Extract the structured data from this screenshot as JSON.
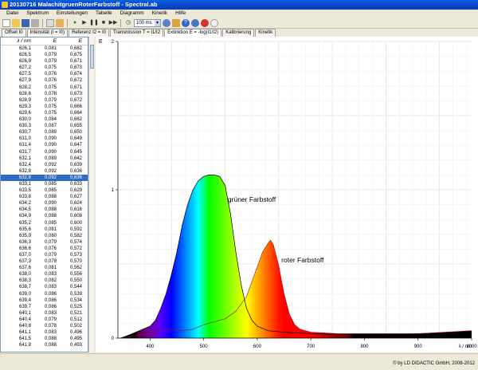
{
  "window": {
    "title": "20130716 MalachitgruenRoterFarbstoff - Spectral.ab"
  },
  "menu": [
    "Datei",
    "Spektrum",
    "Einstellungen",
    "Tabelle",
    "Diagramm",
    "Kinetik",
    "Hilfe"
  ],
  "toolbar": {
    "integration_time": "100 ms",
    "icons": [
      "new-icon",
      "open-icon",
      "save-icon",
      "print-icon",
      "copy-icon",
      "paste-icon",
      "record-icon",
      "play-icon",
      "pause-icon",
      "stop-icon",
      "skip-icon",
      "timer-icon",
      "settings-icon",
      "calibrate-icon",
      "help-icon",
      "info-icon",
      "stop-red-icon",
      "run-icon"
    ]
  },
  "tabs": [
    "Offset I0",
    "Intensität (I = I0)",
    "Referenz I2 = I0",
    "Transmission T = I1/I2",
    "Extinktion E = -log(I1/I2)",
    "Kalibrierung",
    "Kinetik"
  ],
  "active_tab_index": 4,
  "table": {
    "columns": [
      "λ / nm",
      "E",
      "E"
    ],
    "selected_index": 20,
    "rows": [
      [
        "626,1",
        "0,081",
        "0,682"
      ],
      [
        "626,5",
        "0,079",
        "0,675"
      ],
      [
        "626,9",
        "0,079",
        "0,671"
      ],
      [
        "627,2",
        "0,075",
        "0,673"
      ],
      [
        "627,5",
        "0,076",
        "0,674"
      ],
      [
        "627,9",
        "0,076",
        "0,672"
      ],
      [
        "628,2",
        "0,075",
        "0,671"
      ],
      [
        "628,6",
        "0,078",
        "0,673"
      ],
      [
        "628,9",
        "0,079",
        "0,672"
      ],
      [
        "629,3",
        "0,075",
        "0,666"
      ],
      [
        "629,6",
        "0,075",
        "0,664"
      ],
      [
        "630,0",
        "0,084",
        "0,662"
      ],
      [
        "630,3",
        "0,087",
        "0,655"
      ],
      [
        "630,7",
        "0,089",
        "0,650"
      ],
      [
        "631,0",
        "0,090",
        "0,649"
      ],
      [
        "631,4",
        "0,090",
        "0,647"
      ],
      [
        "631,7",
        "0,090",
        "0,645"
      ],
      [
        "632,1",
        "0,089",
        "0,642"
      ],
      [
        "632,4",
        "0,092",
        "0,639"
      ],
      [
        "632,8",
        "0,092",
        "0,636"
      ],
      [
        "632,8",
        "0,092",
        "0,636"
      ],
      [
        "633,1",
        "0,085",
        "0,633"
      ],
      [
        "633,5",
        "0,085",
        "0,629"
      ],
      [
        "633,8",
        "0,088",
        "0,627"
      ],
      [
        "634,2",
        "0,090",
        "0,624"
      ],
      [
        "634,5",
        "0,088",
        "0,616"
      ],
      [
        "634,9",
        "0,088",
        "0,608"
      ],
      [
        "635,2",
        "0,085",
        "0,600"
      ],
      [
        "635,6",
        "0,081",
        "0,592"
      ],
      [
        "635,9",
        "0,080",
        "0,582"
      ],
      [
        "636,3",
        "0,079",
        "0,574"
      ],
      [
        "636,6",
        "0,076",
        "0,572"
      ],
      [
        "637,0",
        "0,079",
        "0,573"
      ],
      [
        "637,3",
        "0,078",
        "0,570"
      ],
      [
        "637,6",
        "0,081",
        "0,562"
      ],
      [
        "638,0",
        "0,083",
        "0,556"
      ],
      [
        "638,3",
        "0,082",
        "0,550"
      ],
      [
        "638,7",
        "0,083",
        "0,544"
      ],
      [
        "639,0",
        "0,086",
        "0,539"
      ],
      [
        "639,4",
        "0,086",
        "0,534"
      ],
      [
        "639,7",
        "0,086",
        "0,525"
      ],
      [
        "640,1",
        "0,083",
        "0,521"
      ],
      [
        "640,4",
        "0,079",
        "0,512"
      ],
      [
        "640,8",
        "0,078",
        "0,502"
      ],
      [
        "641,1",
        "0,083",
        "0,496"
      ],
      [
        "641,5",
        "0,088",
        "0,495"
      ],
      [
        "641,8",
        "0,088",
        "0,493"
      ]
    ]
  },
  "chart_data": {
    "type": "area",
    "ylabel": "E",
    "xlabel": "λ / nm",
    "xlim": [
      340,
      1000
    ],
    "ylim": [
      0,
      2
    ],
    "x_ticks": [
      400,
      500,
      600,
      700,
      800,
      900,
      1000
    ],
    "y_ticks": [
      0,
      1,
      2
    ],
    "grid": true,
    "series": [
      {
        "name": "grüner Farbstoff",
        "x": [
          345,
          360,
          380,
          400,
          410,
          420,
          430,
          440,
          450,
          460,
          470,
          480,
          490,
          500,
          510,
          520,
          530,
          540,
          550,
          560,
          570,
          580,
          590,
          600,
          620,
          650,
          700,
          800,
          900,
          1000
        ],
        "y": [
          0.0,
          0.02,
          0.05,
          0.08,
          0.12,
          0.2,
          0.3,
          0.43,
          0.58,
          0.76,
          0.9,
          1.0,
          1.06,
          1.09,
          1.1,
          1.1,
          1.09,
          1.03,
          0.84,
          0.58,
          0.36,
          0.2,
          0.12,
          0.08,
          0.05,
          0.04,
          0.03,
          0.02,
          0.03,
          0.04
        ]
      },
      {
        "name": "roter Farbstoff",
        "x": [
          345,
          380,
          400,
          420,
          440,
          460,
          480,
          500,
          520,
          540,
          560,
          580,
          600,
          610,
          620,
          625,
          630,
          640,
          650,
          660,
          670,
          680,
          700,
          750,
          800,
          900,
          1000
        ],
        "y": [
          0.0,
          0.02,
          0.03,
          0.05,
          0.06,
          0.05,
          0.06,
          0.09,
          0.11,
          0.13,
          0.18,
          0.28,
          0.48,
          0.58,
          0.64,
          0.66,
          0.63,
          0.49,
          0.3,
          0.16,
          0.09,
          0.06,
          0.04,
          0.03,
          0.03,
          0.03,
          0.05
        ]
      }
    ]
  },
  "status": {
    "copyright": "© by LD DIDACTIC GmbH, 2008-2012"
  }
}
